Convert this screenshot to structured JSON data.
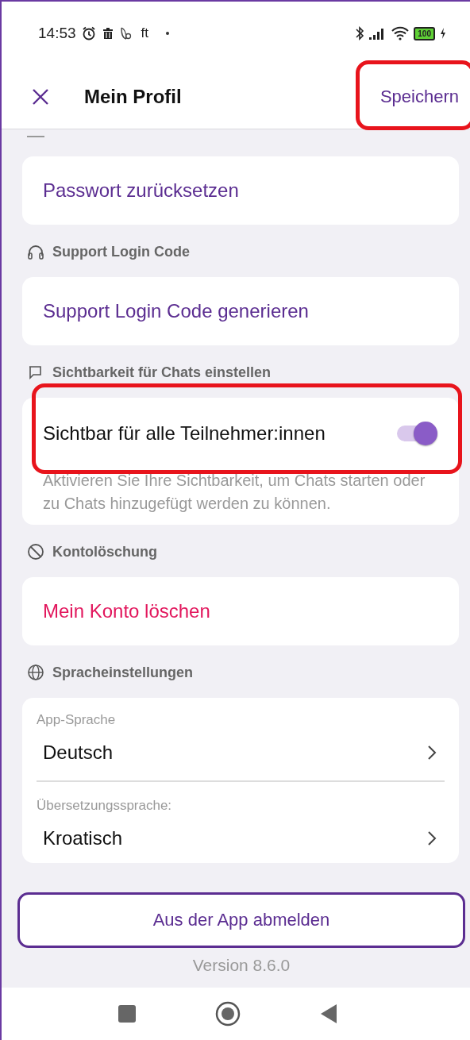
{
  "status_bar": {
    "time": "14:53",
    "text_icon": "ft",
    "battery": "100"
  },
  "header": {
    "title": "Mein Profil",
    "save": {
      "label": "Speichern",
      "highlighted": true
    }
  },
  "sections": [
    {
      "kind": "action",
      "action": {
        "label": "Passwort zurücksetzen",
        "destructive": false
      }
    },
    {
      "kind": "action",
      "title": "Support Login Code",
      "action": {
        "label": "Support Login Code generieren",
        "destructive": false
      }
    },
    {
      "kind": "toggle",
      "title": "Sichtbarkeit für Chats einstellen",
      "toggle": {
        "label": "Sichtbar für alle Teilnehmer:innen",
        "on": true,
        "highlighted": true
      },
      "description": "Aktivieren Sie Ihre Sichtbarkeit, um Chats starten oder zu Chats hinzugefügt werden zu können."
    },
    {
      "kind": "action",
      "title": "Kontolöschung",
      "action": {
        "label": "Mein Konto löschen",
        "destructive": true
      }
    },
    {
      "kind": "selects",
      "title": "Spracheinstellungen",
      "selects": [
        {
          "label": "App-Sprache",
          "value": "Deutsch"
        },
        {
          "label": "Übersetzungssprache:",
          "value": "Kroatisch"
        }
      ]
    }
  ],
  "logout": "Aus der App abmelden",
  "version": "Version 8.6.0"
}
